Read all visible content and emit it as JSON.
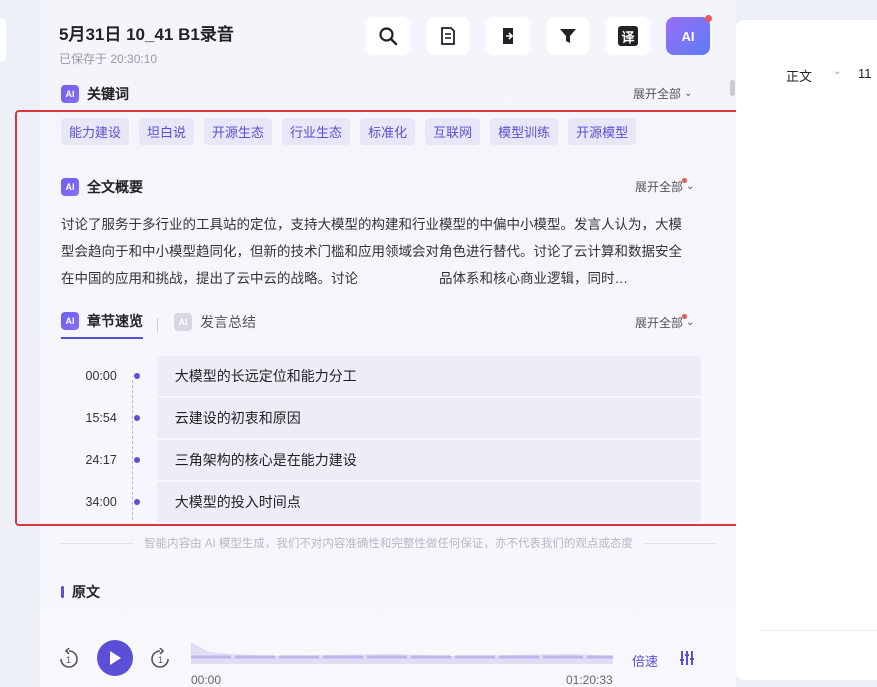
{
  "header": {
    "title": "5月31日 10_41 B1录音",
    "saved": "已保存于 20:30:10"
  },
  "toolbar": {
    "icons": [
      "search-icon",
      "document-list-icon",
      "export-icon",
      "filter-icon",
      "translate-icon",
      "ai-icon"
    ],
    "translate_glyph": "译",
    "ai_glyph": "AI"
  },
  "keywords": {
    "title": "关键词",
    "expand": "展开全部",
    "tags": [
      "能力建设",
      "坦白说",
      "开源生态",
      "行业生态",
      "标准化",
      "互联网",
      "模型训练",
      "开源模型"
    ]
  },
  "summary": {
    "title": "全文概要",
    "expand": "展开全部",
    "text": "讨论了服务于多行业的工具站的定位，支持大模型的构建和行业模型的中偏中小模型。发言人认为，大模型会趋向于和中小模型趋同化，但新的技术门槛和应用领域会对角色进行替代。讨论了云计算和数据安全在中国的应用和挑战，提出了云中云的战略。讨论　　　　　　品体系和核心商业逻辑，同时…"
  },
  "chapters": {
    "tab_active": "章节速览",
    "tab_inactive": "发言总结",
    "expand": "展开全部",
    "items": [
      {
        "time": "00:00",
        "title": "大模型的长远定位和能力分工"
      },
      {
        "time": "15:54",
        "title": "云建设的初衷和原因"
      },
      {
        "time": "24:17",
        "title": "三角架构的核心是在能力建设"
      },
      {
        "time": "34:00",
        "title": "大模型的投入时间点"
      }
    ]
  },
  "disclaimer": "智能内容由 AI 模型生成，我们不对内容准确性和完整性做任何保证，亦不代表我们的观点或态度",
  "original": {
    "title": "原文"
  },
  "player": {
    "current": "00:00",
    "total": "01:20:33",
    "speed": "倍速",
    "progress_fraction": 0
  },
  "right_panel": {
    "style": "正文",
    "size": "11"
  },
  "colors": {
    "accent": "#5a4fd6",
    "highlight_border": "#d9363e",
    "tag_bg": "#e8e7f8"
  }
}
